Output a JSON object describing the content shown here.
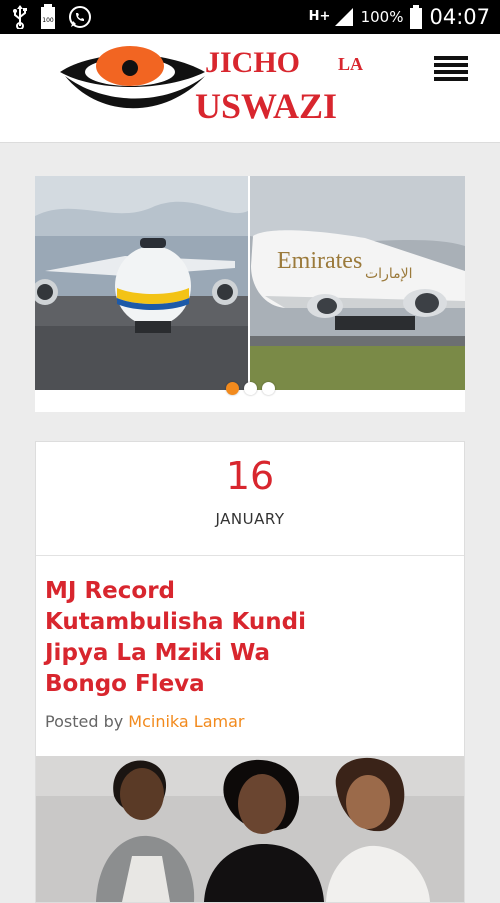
{
  "status_bar": {
    "battery_percent": "100%",
    "network_label": "H+",
    "time": "04:07",
    "left_icons": [
      "usb-icon",
      "battery-full-icon",
      "whatsapp-icon"
    ]
  },
  "header": {
    "logo_text_top": "JICHO",
    "logo_text_small": "LA",
    "logo_text_bottom": "USWAZI",
    "colors": {
      "logo_red": "#d8262e",
      "logo_orange": "#f26522"
    }
  },
  "slider": {
    "slides_count": 3,
    "active_index": 0,
    "active_dot_color": "#f28a1d",
    "airline_text": "Emirates",
    "airline_arabic": "الإمارات"
  },
  "post": {
    "date_day": "16",
    "date_month": "JANUARY",
    "title": "MJ Record Kutambulisha Kundi Jipya La Mziki Wa Bongo Fleva",
    "posted_by_label": "Posted by",
    "author": "Mcinika Lamar",
    "colors": {
      "title": "#d8262e",
      "author": "#f28a1d"
    }
  }
}
